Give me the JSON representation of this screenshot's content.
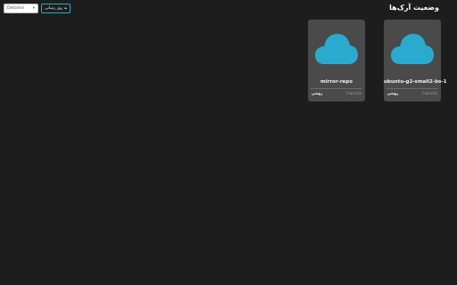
{
  "header": {
    "title": "وضعیت آرک‌ها"
  },
  "toolbar": {
    "select_value": "Detailed",
    "refresh_label": "به روز رسانی"
  },
  "cards": [
    {
      "name": "ubuntu-g2-small2-bs-1",
      "status": "Capacity",
      "state": "روشن"
    },
    {
      "name": "mirror-repo",
      "status": "Capacity",
      "state": "روشن"
    }
  ],
  "colors": {
    "cloud": "#2aaacf",
    "card": "#4a4a4a",
    "background": "#1d1d1d",
    "accent": "#19b5c8"
  }
}
